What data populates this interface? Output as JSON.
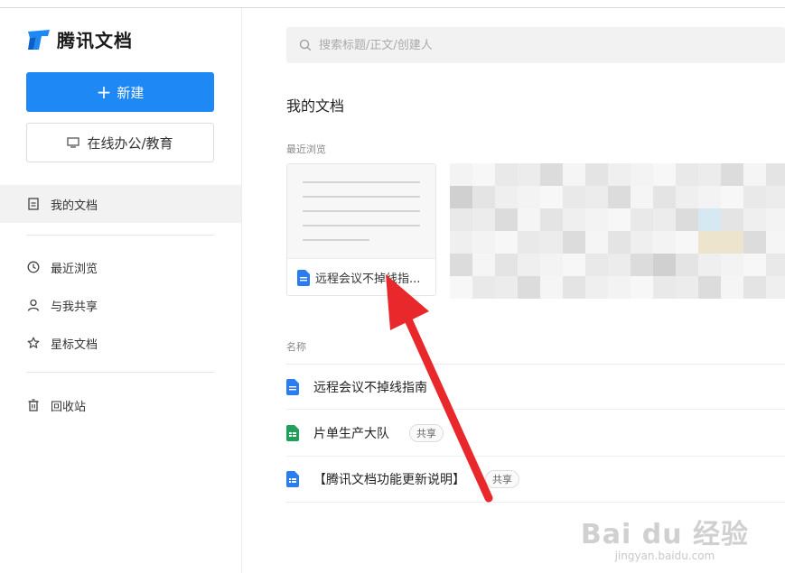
{
  "app": {
    "logo_text": "腾讯文档"
  },
  "sidebar": {
    "new_button": "新建",
    "office_button": "在线办公/教育",
    "items": [
      {
        "label": "我的文档",
        "icon": "document-icon",
        "active": true
      },
      {
        "label": "最近浏览",
        "icon": "clock-icon"
      },
      {
        "label": "与我共享",
        "icon": "user-icon"
      },
      {
        "label": "星标文档",
        "icon": "star-icon"
      },
      {
        "label": "回收站",
        "icon": "trash-icon"
      }
    ]
  },
  "search": {
    "placeholder": "搜索标题/正文/创建人"
  },
  "main": {
    "title": "我的文档",
    "recent_label": "最近浏览",
    "recent_cards": [
      {
        "name": "远程会议不掉线指..."
      }
    ],
    "list_header": "名称",
    "docs": [
      {
        "name": "远程会议不掉线指南",
        "type": "doc",
        "badge": ""
      },
      {
        "name": "片单生产大队",
        "type": "sheet",
        "badge": "共享"
      },
      {
        "name": "【腾讯文档功能更新说明】",
        "type": "doc-form",
        "badge": "共享"
      }
    ]
  },
  "colors": {
    "accent": "#1e88f5",
    "doc_blue": "#2b7cf0",
    "sheet_green": "#1fa15a",
    "arrow_red": "#e8282b"
  },
  "watermark": {
    "big": "Bai du 经验",
    "small": "jingyan.baidu.com"
  }
}
